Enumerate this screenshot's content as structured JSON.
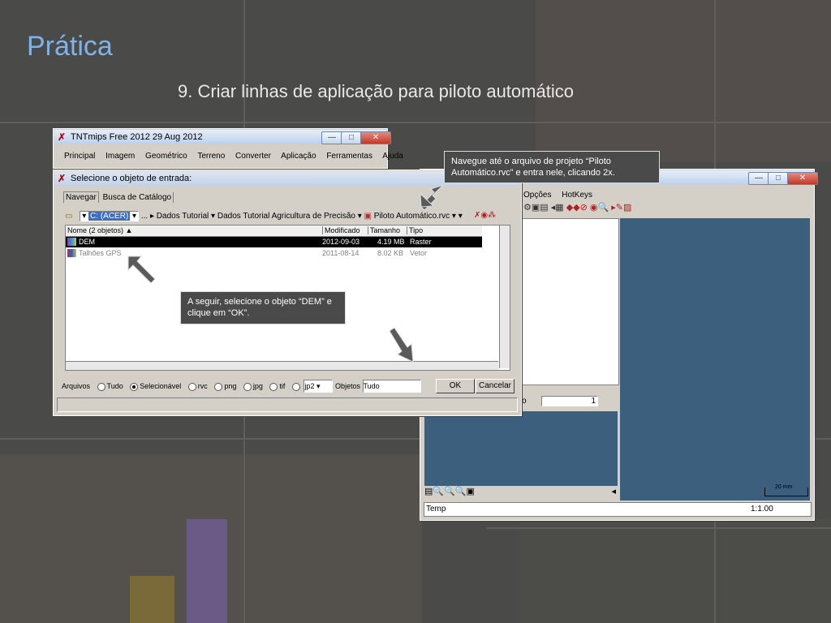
{
  "slide": {
    "title": "Prática",
    "subtitle": "9. Criar linhas de aplicação para piloto automático"
  },
  "main_window": {
    "title": "TNTmips Free 2012   29 Aug 2012",
    "menu": [
      "Principal",
      "Imagem",
      "Geométrico",
      "Terreno",
      "Converter",
      "Aplicação",
      "Ferramentas",
      "Ajuda"
    ],
    "controls": {
      "minimize": "—",
      "maximize": "□",
      "close": "✕"
    }
  },
  "view_window": {
    "menu": [
      "Opções",
      "HotKeys"
    ],
    "scale": "1:1.00",
    "status_left": "Temp",
    "scalebar_label": "20 mm",
    "spinner_value": "1",
    "layer_field": "o"
  },
  "dialog": {
    "title": "Selecione o objeto de entrada:",
    "tabs": [
      "Navegar",
      "Busca de Catálogo"
    ],
    "path": {
      "drive": "C: (ACER)",
      "crumbs": [
        "... ▸",
        "Dados Tutorial",
        "Dados Tutorial Agricultura de Precisão",
        "Piloto Automático.rvc"
      ]
    },
    "columns": [
      "Nome  (2 objetos)  ▲",
      "Modificado",
      "Tamanho",
      "Tipo"
    ],
    "rows": [
      {
        "name": "DEM",
        "modified": "2012-09-03",
        "size": "4.19 MB",
        "type": "Raster",
        "selected": true
      },
      {
        "name": "Talhões GPS",
        "modified": "2011-08-14",
        "size": "8.02 KB",
        "type": "Vetor",
        "selected": false
      }
    ],
    "filter": {
      "label": "Arquivos",
      "options": [
        "Tudo",
        "Selecionável",
        "rvc",
        "png",
        "jpg",
        "tif"
      ],
      "selected": "Selecionável",
      "format": "jp2",
      "objects_label": "Objetos",
      "objects_value": "Tudo"
    },
    "ok": "OK",
    "cancel": "Cancelar"
  },
  "callouts": {
    "navigate": "Navegue até o arquivo de projeto “Piloto Automático.rvc” e entra nele, clicando 2x.",
    "select": "A seguir, selecione o objeto “DEM”  e clique em “OK”."
  },
  "colors": {
    "title": "#7fb2e6",
    "selection": "#000000",
    "map_blue": "#3d5f7e"
  }
}
